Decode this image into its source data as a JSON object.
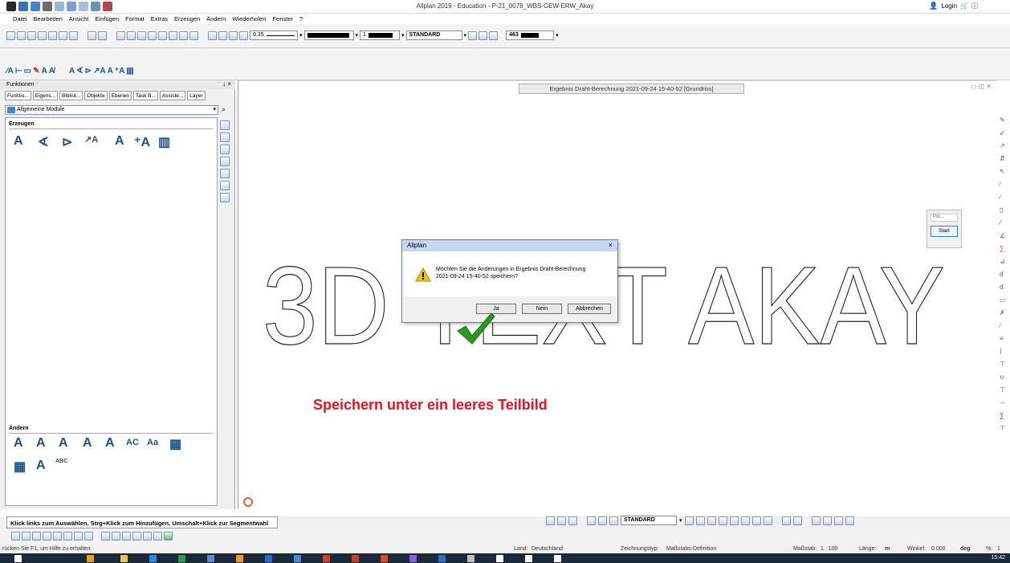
{
  "app": {
    "title": "Allplan 2019 - Education - P-21_0078_WBS-GEW-ERW_Akay",
    "login_label": "Login"
  },
  "menu": [
    "Datei",
    "Bearbeiten",
    "Ansicht",
    "Einfügen",
    "Format",
    "Extras",
    "Erzeugen",
    "Ändern",
    "Wiederholen",
    "Fenster",
    "?"
  ],
  "toolbar": {
    "pen_thickness": "0.35",
    "line_type": "1",
    "pattern": "STANDARD",
    "color_index": "463"
  },
  "panel": {
    "title": "Funktionen",
    "pin": "↓ ×",
    "tabs": [
      "Funktio...",
      "Eigens...",
      "Bibliot...",
      "Objekte",
      "Ebenen",
      "Task B...",
      "Assiste...",
      "Layer"
    ],
    "module": "Allgemeine Module",
    "section_create": "Erzeugen",
    "section_modify": "Ändern",
    "create_glyphs": [
      "A",
      "∢",
      "⊳",
      "↗A",
      "A",
      "⁺A",
      "▥"
    ],
    "modify_glyphs": [
      "A",
      "A",
      "A",
      "A",
      "A",
      "AC",
      "Aa",
      "▦"
    ],
    "modify_glyphs2": [
      "▦",
      "A",
      "ABC"
    ]
  },
  "document": {
    "tab_title": "Ergebnis Draht-Berechnung  2021-09-24  15-40-52  [Grundriss]",
    "big_text": "3D TEXT AKAY",
    "annotation": "Speichern unter ein leeres Teilbild"
  },
  "start_box": {
    "poi": "Poi...",
    "start": "Start"
  },
  "dialog": {
    "title": "Allplan",
    "close": "×",
    "message_line1": "Möchten Sie die Änderungen in Ergebnis Draht-Berechnung",
    "message_line2": "2021-09-24 15-40-52 speichern?",
    "yes": "Ja",
    "no": "Nein",
    "cancel": "Abbrechen",
    "accent": "#c6d7ef"
  },
  "status": {
    "hint": "Klick links zum Auswählen, Strg+Klick zum Hinzufügen, Umschalt+Klick zur Segmentwahl",
    "f1_hint": "rücken Sie F1, um Hilfe zu erhalten.",
    "land_label": "Land:",
    "land_value": "Deutschland",
    "drawing_type_label": "Zeichnungstyp:",
    "drawing_type_value": "Maßstabs-Definition",
    "scale_label": "Maßstab:",
    "scale_value": "1 : 100",
    "length_label": "Länge:",
    "length_value": "m",
    "angle_label": "Winkel:",
    "angle_value": "0.000",
    "angle_unit": "deg",
    "percent_label": "%:",
    "percent_value": "1",
    "bottom_pattern": "STANDARD",
    "clock": "15:42"
  }
}
